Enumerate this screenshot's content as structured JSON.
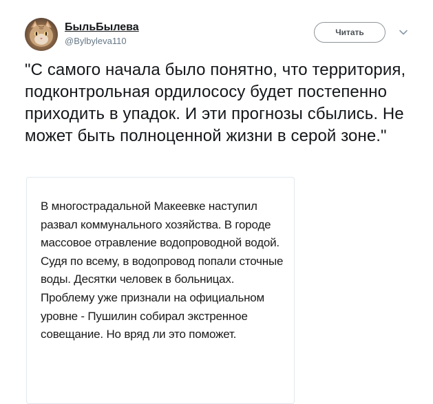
{
  "author": {
    "display_name": "БыльБылева",
    "handle": "@Bylbyleva110",
    "avatar": "cat-photo-avatar"
  },
  "actions": {
    "follow_label": "Читать",
    "more_icon": "chevron-down-icon"
  },
  "tweet": {
    "text": "\"С самого начала было понятно, что территория, подконтрольная ордилососу будет постепенно приходить в упадок. И эти прогнозы сбылись. Не может быть полноценной жизни в серой зоне.\""
  },
  "quote": {
    "text": "В многострадальной Макеевке наступил развал коммунального хозяйства. В городе массовое отравление водопроводной водой. Судя по всему, в водопровод попали сточные воды. Десятки человек в больницах. Проблему уже признали на официальном уровне - Пушилин собирал экстренное совещание. Но вряд ли это поможет."
  },
  "colors": {
    "text_primary": "#14171a",
    "text_secondary": "#657786",
    "border": "#e1e8ed",
    "button_border": "#8e9499"
  }
}
